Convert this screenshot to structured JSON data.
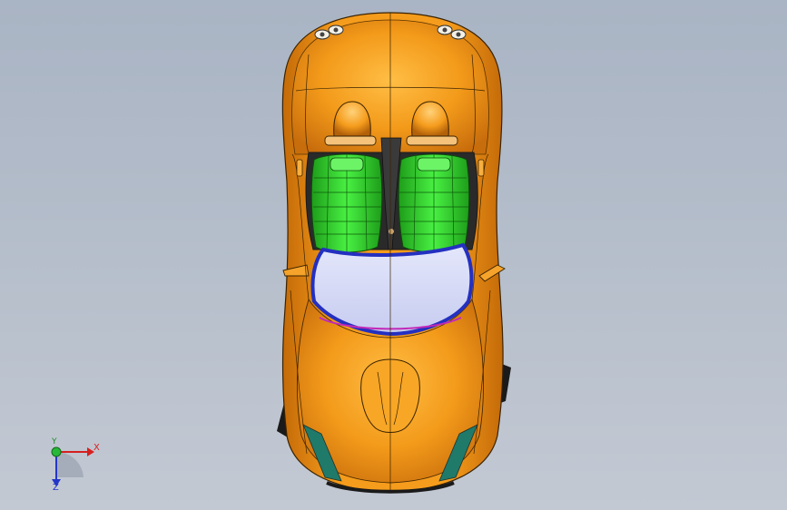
{
  "viewport": {
    "background_top": "#a9b4c4",
    "background_bottom": "#c3c9d3"
  },
  "model": {
    "name": "sports-car-top-view",
    "body_color": "#f39a1a",
    "seat_color": "#3fe03a",
    "windshield_color": "#d4d9f6",
    "windshield_trim_color": "#2430c0",
    "side_vent_color": "#1f7a6a"
  },
  "triad": {
    "x_label": "X",
    "y_label": "Y",
    "z_label": "Z",
    "x_color": "#d62020",
    "y_color": "#1f8a2a",
    "z_color": "#2436c8"
  }
}
